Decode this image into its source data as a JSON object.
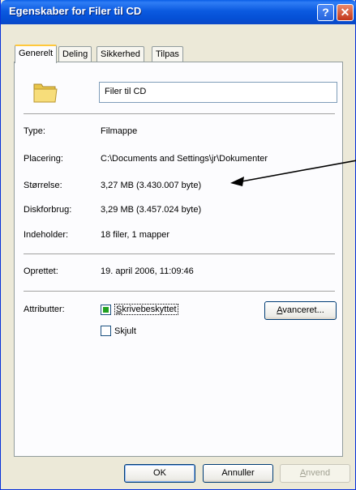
{
  "window": {
    "title": "Egenskaber for Filer til CD",
    "help_glyph": "?",
    "close_glyph": "✕"
  },
  "tabs": [
    {
      "label": "Generelt",
      "active": true
    },
    {
      "label": "Deling"
    },
    {
      "label": "Sikkerhed"
    },
    {
      "label": "Tilpas"
    }
  ],
  "general": {
    "name_value": "Filer til CD",
    "icon": "folder-icon",
    "type_label": "Type:",
    "type_value": "Filmappe",
    "location_label": "Placering:",
    "location_value": "C:\\Documents and Settings\\jr\\Dokumenter",
    "size_label": "Størrelse:",
    "size_value": "3,27 MB (3.430.007 byte)",
    "disk_label": "Diskforbrug:",
    "disk_value": "3,29 MB (3.457.024 byte)",
    "contains_label": "Indeholder:",
    "contains_value": "18 filer, 1 mapper",
    "created_label": "Oprettet:",
    "created_value": "19. april 2006, 11:09:46",
    "attributes_label": "Attributter:",
    "readonly": {
      "pre": "",
      "accel": "S",
      "post": "krivebeskyttet",
      "state": "mixed"
    },
    "hidden": {
      "pre": "Sk",
      "accel": "j",
      "post": "ult",
      "state": "unchecked"
    },
    "advanced": {
      "pre": "",
      "accel": "A",
      "post": "vanceret..."
    }
  },
  "buttons": {
    "ok": "OK",
    "cancel": "Annuller",
    "apply": {
      "accel": "A",
      "post": "nvend"
    }
  },
  "colors": {
    "titlebar": "#0a5ee6",
    "dialog_bg": "#ece9d8",
    "tab_highlight": "#ffc83c",
    "checkbox_mixed": "#21a121"
  }
}
